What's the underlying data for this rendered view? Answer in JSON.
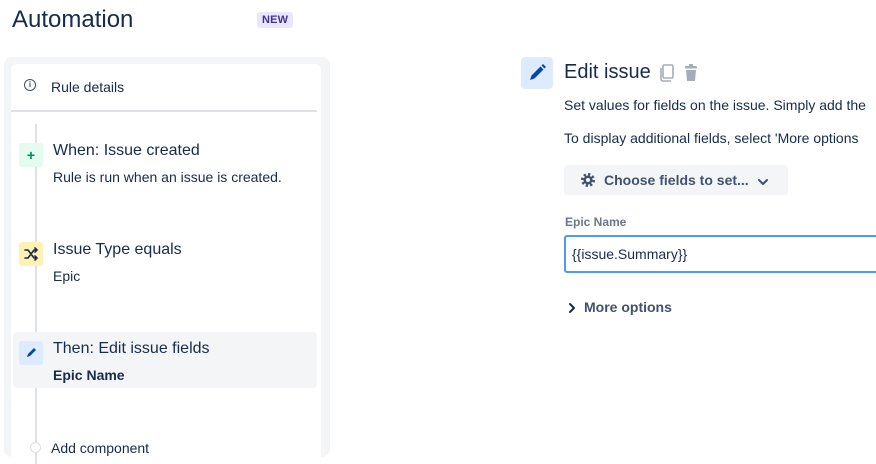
{
  "header": {
    "title": "Automation",
    "badge": "NEW"
  },
  "rule": {
    "details_label": "Rule details",
    "components": [
      {
        "title": "When: Issue created",
        "subtitle": "Rule is run when an issue is created.",
        "icon": "plus-icon",
        "color": "#e3fcef",
        "icon_color": "#00875a"
      },
      {
        "title": "Issue Type equals",
        "subtitle": "Epic",
        "icon": "shuffle-icon",
        "color": "#fff0b3",
        "icon_color": "#172b4d"
      },
      {
        "title": "Then: Edit issue fields",
        "subtitle": "Epic Name",
        "icon": "pencil-icon",
        "color": "#deebff",
        "icon_color": "#0747a6",
        "selected": true
      }
    ],
    "add_component_label": "Add component"
  },
  "detail": {
    "title": "Edit issue",
    "description": "Set values for fields on the issue. Simply add the",
    "hint": "To display additional fields, select 'More options",
    "choose_fields_label": "Choose fields to set...",
    "field": {
      "label": "Epic Name",
      "value": "{{issue.Summary}}"
    },
    "more_options_label": "More options"
  },
  "colors": {
    "accent": "#0052cc",
    "focus": "#4c9aff",
    "badge_bg": "#eae6ff",
    "badge_text": "#403294"
  }
}
